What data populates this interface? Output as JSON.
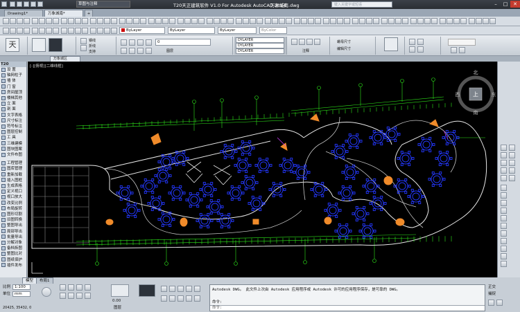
{
  "window": {
    "title": "T20天正建筑软件 V1.0 For Autodesk AutoCAD 2014",
    "document": "万象城南.dwg",
    "workspace": "草图与注释",
    "search_placeholder": "键入关键字或短语"
  },
  "tabs": [
    {
      "label": "Drawing1*"
    },
    {
      "label": "万象城南*"
    }
  ],
  "layer_bar": {
    "layer_value": "ByLayer",
    "color_value": "ByLayer",
    "linetype_value": "ByLayer",
    "lineweight_value": "ByColor"
  },
  "ribbon": {
    "layer_items": [
      "0",
      "DYLAYER",
      "DYLAYER",
      "DYLAYER"
    ],
    "panel_labels": [
      "钢线",
      "折线",
      "支持",
      "图层",
      "注释",
      "块",
      "特性",
      "组",
      "实用工具",
      "剪贴板"
    ],
    "right_labels": [
      "螺母尺寸",
      "编辑尺寸"
    ]
  },
  "doctab": {
    "label": "万象城区"
  },
  "viewport_label": "[-][俯视][二维线框]",
  "palette": {
    "header": "T20",
    "items": [
      "设 置",
      "轴网柱子",
      "墙 体",
      "门 窗",
      "房间屋顶",
      "楼梯其他",
      "立 面",
      "剖 面",
      "文字表格",
      "尺寸标注",
      "符号标注",
      "图层控制",
      "工 具",
      "三维建模",
      "图块图案",
      "文件布图",
      "工程管理",
      "图库管理",
      "重新加载",
      "插入图框",
      "生成表格",
      "定义视口",
      "视口放大",
      "改变比例",
      "布局旋转",
      "图形切割",
      "旧图转换",
      "整图导出",
      "局部导出",
      "批量导出",
      "分解对象",
      "备档拆图",
      "整图比对",
      "图纸保护",
      "插件发布"
    ]
  },
  "viewcube": {
    "north": "北",
    "east": "东",
    "south": "南",
    "west": "西",
    "top": "上"
  },
  "bottom": {
    "model_tab": "模型",
    "layout_tab": "布局1",
    "scale_label": "比例",
    "scale_value": "1:100",
    "unit_label": "单位",
    "unit_value": "mm",
    "coords": "20425, 35432, 0",
    "lineweight_value": "0.00",
    "ortho_label": "正交",
    "grid_label": "捕捉",
    "bottom_btn": "图层"
  },
  "command": {
    "history": [
      "Autodesk DWG。  此文件上次由 Autodesk 应用程序或 Autodesk 许可的应用程序保存，是可靠的 DWG。"
    ],
    "prompt": "命令:",
    "input_placeholder": "命令:"
  },
  "colors": {
    "canvas_bg": "#000000",
    "line_green": "#2ee81a",
    "line_blue": "#2438ff",
    "line_white": "#e8e8e8",
    "accent_orange": "#f08b2a",
    "line_magenta": "#d43bff"
  }
}
